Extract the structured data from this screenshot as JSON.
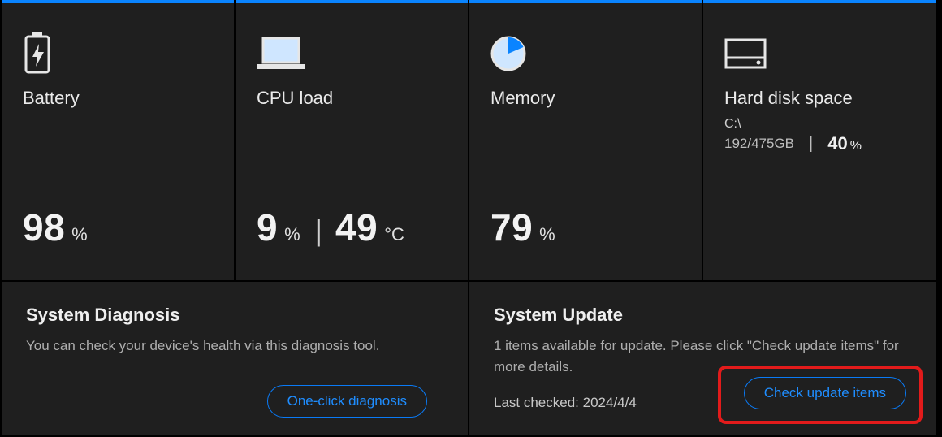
{
  "cards": {
    "battery": {
      "title": "Battery",
      "value": "98",
      "unit": "%"
    },
    "cpu": {
      "title": "CPU load",
      "value": "9",
      "unit": "%",
      "temp": "49",
      "temp_unit": "°C"
    },
    "memory": {
      "title": "Memory",
      "value": "79",
      "unit": "%"
    },
    "disk": {
      "title": "Hard disk space",
      "drive": "C:\\",
      "usage": "192/475GB",
      "percent": "40",
      "percent_unit": "%"
    }
  },
  "diagnosis": {
    "title": "System Diagnosis",
    "desc": "You can check your device's health via this diagnosis tool.",
    "button": "One-click diagnosis"
  },
  "update": {
    "title": "System Update",
    "desc": "1 items available for update. Please click \"Check update items\" for more details.",
    "checked": "Last checked: 2024/4/4",
    "button": "Check update items"
  }
}
